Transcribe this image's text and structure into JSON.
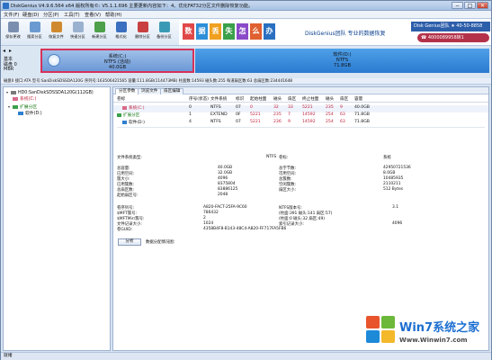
{
  "window": {
    "title": "DiskGenius V4.9.6.564 x64    版权所有©: V5.1.1.696  主要更新内容如下：4、优化FAT32分区文件删除恢复功能。",
    "minimize": "‒",
    "maximize": "□",
    "close": "✕"
  },
  "menu": [
    "文件(F)",
    "硬盘(D)",
    "分区(P)",
    "工具(T)",
    "查看(V)",
    "帮助(H)"
  ],
  "toolbar": [
    {
      "label": "保存更改",
      "icon": "save-icon",
      "color": "#7a8fb0"
    },
    {
      "label": "搜索分区",
      "icon": "search-partition-icon",
      "color": "#6a9ad0"
    },
    {
      "label": "恢复文件",
      "icon": "recover-file-icon",
      "color": "#d08a2e"
    },
    {
      "label": "快速分区",
      "icon": "quick-partition-icon",
      "color": "#9ab2cf"
    },
    {
      "label": "新建分区",
      "icon": "new-partition-icon",
      "color": "#4ea04a"
    },
    {
      "label": "格式化",
      "icon": "format-icon",
      "color": "#3b6fbf"
    },
    {
      "label": "删除分区",
      "icon": "delete-partition-icon",
      "color": "#c84040"
    },
    {
      "label": "备份分区",
      "icon": "backup-partition-icon",
      "color": "#3a9ab5"
    }
  ],
  "ad": {
    "chars": [
      "数",
      "据",
      "丢",
      "失",
      "怎",
      "么",
      "办"
    ],
    "colors": [
      "#e04848",
      "#2e8fd8",
      "#f0a020",
      "#3aa04a",
      "#8a4ac8",
      "#e06030",
      "#2a70c0"
    ],
    "slogan": "DiskGenius团队 专业的数据恢复",
    "bar": "Disk Genius团队 ★ 40-50-8858",
    "phone": "☎ 4000089958转1"
  },
  "diskmap": {
    "back": "◂",
    "forward": "▸",
    "disk_no": "磁盘 0",
    "disk_kind": "基本",
    "disk_style": "MBR"
  },
  "partitions": [
    {
      "name": "系统(C:)",
      "fs": "NTFS (活动)",
      "size": "40.0GB"
    },
    {
      "name": "软件(D:)",
      "fs": "NTFS",
      "size": "71.8GB"
    }
  ],
  "infoline": "磁盘0 接口:ATA  型号:SanDiskSDSSDA120G  序列号:163506421565  容量:111.8GB(114473MB)  柱面数:14593  磁头数:255  每道扇区数:63  总扇区数:234441648",
  "tree": [
    {
      "label": "HD0:SanDiskSDSSDA120G(112GB)",
      "color": "#111",
      "icon_color": "#7a7a7a"
    },
    {
      "label": "系统(C:)",
      "color": "#c0203a",
      "icon_color": "#d96a8a"
    },
    {
      "label": "扩展分区",
      "color": "#1a7a1a",
      "icon_color": "#3aa04a"
    },
    {
      "label": "软件(D:)",
      "color": "#111",
      "icon_color": "#2e7fd0"
    }
  ],
  "tabs": [
    "分区参数",
    "浏览文件",
    "扇区编辑"
  ],
  "table": {
    "headers": [
      "卷标",
      "序号(状态)",
      "文件系统",
      "标识",
      "起始柱面",
      "磁头",
      "扇区",
      "终止柱面",
      "磁头",
      "扇区",
      "容量"
    ],
    "rows": [
      {
        "label": "系统(C:)",
        "values": [
          "0",
          "NTFS",
          "07",
          "0",
          "32",
          "33",
          "5221",
          "235",
          "9",
          "40.0GB"
        ],
        "color": "#c0203a",
        "icon_color": "#d96a8a"
      },
      {
        "label": "扩展分区",
        "values": [
          "1",
          "EXTEND",
          "0F",
          "5221",
          "235",
          "7",
          "14592",
          "254",
          "63",
          "71.8GB"
        ],
        "color": "#1a7a1a",
        "icon_color": "#3aa04a"
      },
      {
        "label": "软件(D:)",
        "values": [
          "4",
          "NTFS",
          "07",
          "5221",
          "236",
          "9",
          "14592",
          "254",
          "63",
          "71.8GB"
        ],
        "color": "#111",
        "icon_color": "#2e7fd0"
      }
    ]
  },
  "details": {
    "fs_type_label": "文件系统类型:",
    "fs_type_value": "NTFS",
    "vol_label_label": "卷标:",
    "vol_label_value": "系统",
    "left": [
      {
        "k": "总容量:",
        "v": "40.0GB"
      },
      {
        "k": "已用空间:",
        "v": "32.0GB"
      },
      {
        "k": "簇大小:",
        "v": "4096"
      },
      {
        "k": "已用簇数:",
        "v": "8375804"
      },
      {
        "k": "总扇区数:",
        "v": "83886125"
      },
      {
        "k": "起始扇区号:",
        "v": "2048"
      }
    ],
    "right": [
      {
        "k": "总字节数:",
        "v": "42950721536"
      },
      {
        "k": "可用空间:",
        "v": "8.0GB"
      },
      {
        "k": "总簇数:",
        "v": "10485935"
      },
      {
        "k": "空闲簇数:",
        "v": "2110211"
      },
      {
        "k": "扇区大小:",
        "v": "512 Bytes"
      }
    ],
    "bottom_left": [
      {
        "k": "卷序列号:",
        "v": "A820-FACT-25FA-9C60"
      },
      {
        "k": "$MFT簇号:",
        "v": "786432"
      },
      {
        "k": "$MFTMirr簇号:",
        "v": "2"
      },
      {
        "k": "文件记录大小:",
        "v": "1024"
      },
      {
        "k": "卷GUID:",
        "v": "4358B4F8-B143-48C4-A820-FF717FA5FB6"
      }
    ],
    "bottom_right": [
      {
        "k": "NTFS版本号:",
        "v": "3.1"
      },
      {
        "k": "(柱面:391 磁头:141 扇区:57)",
        "v": ""
      },
      {
        "k": "(柱面:0 磁头:32 扇区:49)",
        "v": ""
      },
      {
        "k": "索引记录大小:",
        "v": "4096"
      }
    ],
    "analyze_btn": "分析",
    "analyze_text": "数据分配情况图："
  },
  "status": "就绪",
  "watermark": {
    "brand": "Win7系统之家",
    "url": "Www.Winwin7.com"
  }
}
